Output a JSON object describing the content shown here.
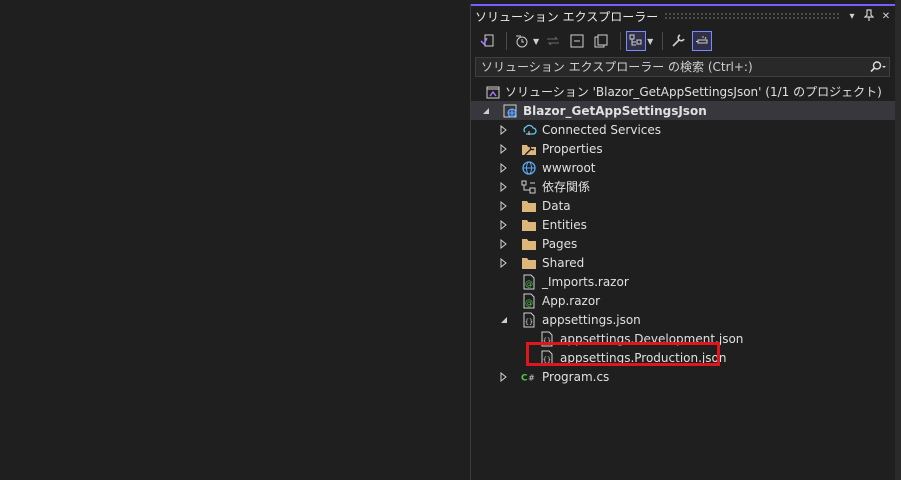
{
  "panel": {
    "title": "ソリューション エクスプローラー",
    "title_buttons": [
      "▾",
      "⊥",
      "✕"
    ]
  },
  "search": {
    "placeholder": "ソリューション エクスプローラー の検索 (Ctrl+:)"
  },
  "tree": {
    "solution_label": "ソリューション 'Blazor_GetAppSettingsJson' (1/1 のプロジェクト)",
    "project_label": "Blazor_GetAppSettingsJson",
    "items": [
      {
        "label": "Connected Services"
      },
      {
        "label": "Properties"
      },
      {
        "label": "wwwroot"
      },
      {
        "label": "依存関係"
      },
      {
        "label": "Data"
      },
      {
        "label": "Entities"
      },
      {
        "label": "Pages"
      },
      {
        "label": "Shared"
      },
      {
        "label": "_Imports.razor"
      },
      {
        "label": "App.razor"
      },
      {
        "label": "appsettings.json"
      },
      {
        "label": "appsettings.Development.json"
      },
      {
        "label": "appsettings.Production.json"
      },
      {
        "label": "Program.cs"
      }
    ]
  },
  "colors": {
    "accent": "#7a5cff",
    "highlight": "#e3151c",
    "folder": "#dcb67a",
    "razor": "#4ec94e"
  }
}
